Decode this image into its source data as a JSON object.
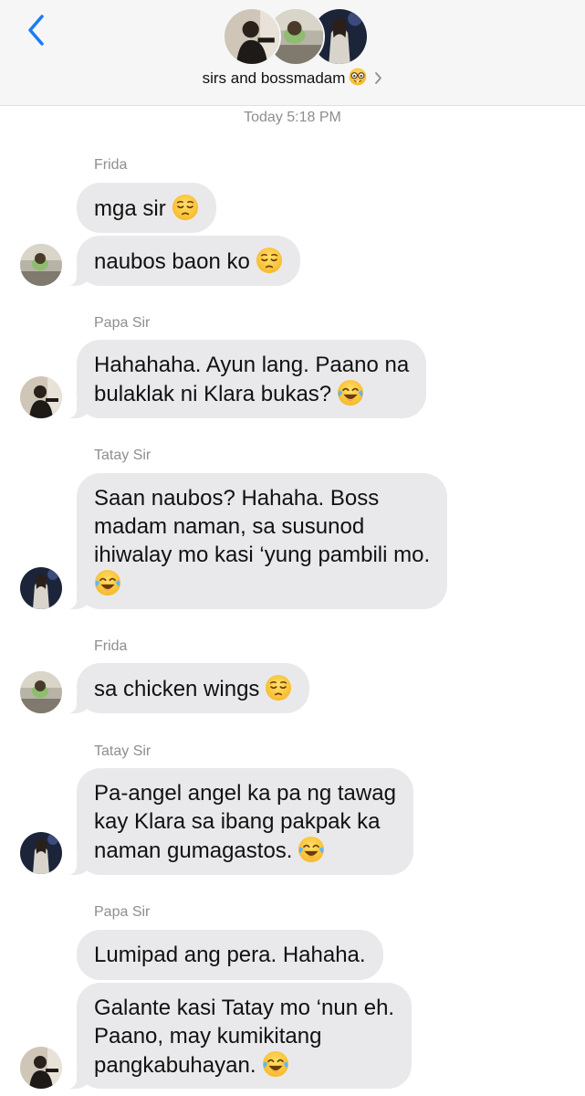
{
  "header": {
    "group_name": "sirs and bossmadam",
    "group_emoji": "nerd-face-emoji",
    "back_icon": "chevron-left-icon",
    "details_icon": "chevron-right-icon",
    "accent_color": "#1a7cf5"
  },
  "timestamp": "Today 5:18 PM",
  "colors": {
    "bubble_bg": "#e9e9eb",
    "sender_label": "#8e8e93"
  },
  "messages": [
    {
      "sender": "Frida",
      "bubbles": [
        {
          "lines": [
            "mga sir"
          ],
          "emoji": "pensive-face-emoji"
        },
        {
          "lines": [
            "naubos baon ko"
          ],
          "emoji": "pensive-face-emoji"
        }
      ]
    },
    {
      "sender": "Papa Sir",
      "bubbles": [
        {
          "lines": [
            "Hahahaha. Ayun lang. Paano na",
            "bulaklak ni Klara bukas?"
          ],
          "emoji": "tears-of-joy-emoji"
        }
      ]
    },
    {
      "sender": "Tatay Sir",
      "bubbles": [
        {
          "lines": [
            "Saan naubos? Hahaha. Boss",
            "madam naman, sa susunod",
            "ihiwalay mo kasi ‘yung pambili mo.",
            ""
          ],
          "emoji": "tears-of-joy-emoji"
        }
      ]
    },
    {
      "sender": "Frida",
      "bubbles": [
        {
          "lines": [
            "sa chicken wings"
          ],
          "emoji": "pensive-face-emoji"
        }
      ]
    },
    {
      "sender": "Tatay Sir",
      "bubbles": [
        {
          "lines": [
            "Pa-angel angel ka pa ng tawag",
            "kay Klara sa ibang pakpak ka",
            "naman gumagastos."
          ],
          "emoji": "tears-of-joy-emoji"
        }
      ]
    },
    {
      "sender": "Papa Sir",
      "bubbles": [
        {
          "lines": [
            "Lumipad ang pera. Hahaha."
          ]
        },
        {
          "lines": [
            "Galante kasi Tatay mo ‘nun eh.",
            "Paano, may kumikitang",
            "pangkabuhayan."
          ],
          "emoji": "tears-of-joy-emoji"
        }
      ]
    }
  ]
}
